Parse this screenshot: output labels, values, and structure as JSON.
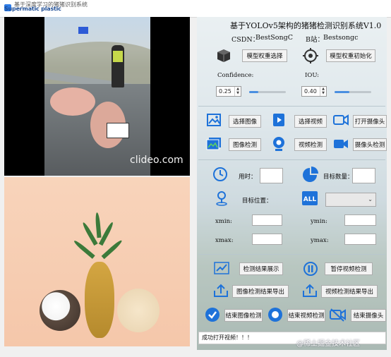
{
  "window": {
    "title": "Supermatic plastic",
    "subtitle": "基于深度学习的猪猪识别系统"
  },
  "video_panel": {
    "watermark": "clideo.com"
  },
  "header": {
    "title": "基于YOLOv5架构的猪猪检测识别系统V1.0",
    "csdn_label": "CSDN：",
    "csdn_value": "BestSongC",
    "bili_label": "B站：",
    "bili_value": "Bestsongc"
  },
  "weights": {
    "select_label": "模型权重选择",
    "init_label": "模型权重初始化"
  },
  "thresholds": {
    "confidence_label": "Confidence:",
    "confidence_value": "0.25",
    "confidence_fraction": 0.25,
    "iou_label": "IOU:",
    "iou_value": "0.40",
    "iou_fraction": 0.4
  },
  "actions": {
    "select_image": "选择图像",
    "select_video": "选择视频",
    "open_camera": "打开摄像头",
    "image_detect": "图像检测",
    "video_detect": "视频检测",
    "camera_detect": "摄像头检测"
  },
  "results": {
    "time_label": "用时：",
    "time_value": "",
    "count_label": "目标数量：",
    "count_value": "",
    "position_label": "目标位置：",
    "target_select_value": "",
    "xmin_label": "xmin:",
    "ymin_label": "ymin:",
    "xmax_label": "xmax:",
    "ymax_label": "ymax:"
  },
  "bottom_actions": {
    "show_results": "检测结果展示",
    "pause_video": "暂停视频检测",
    "export_image": "图像检测结果导出",
    "export_video": "视频检测结果导出",
    "end_image": "结束图像检测",
    "end_video": "结束视频检测",
    "end_camera": "结束摄像头"
  },
  "status": {
    "message": "成功打开视频！！！"
  },
  "footer": {
    "watermark": "@稀土掘金技术社区"
  },
  "colors": {
    "accent": "#2d7be5",
    "icon_blue": "#1e72d9"
  }
}
